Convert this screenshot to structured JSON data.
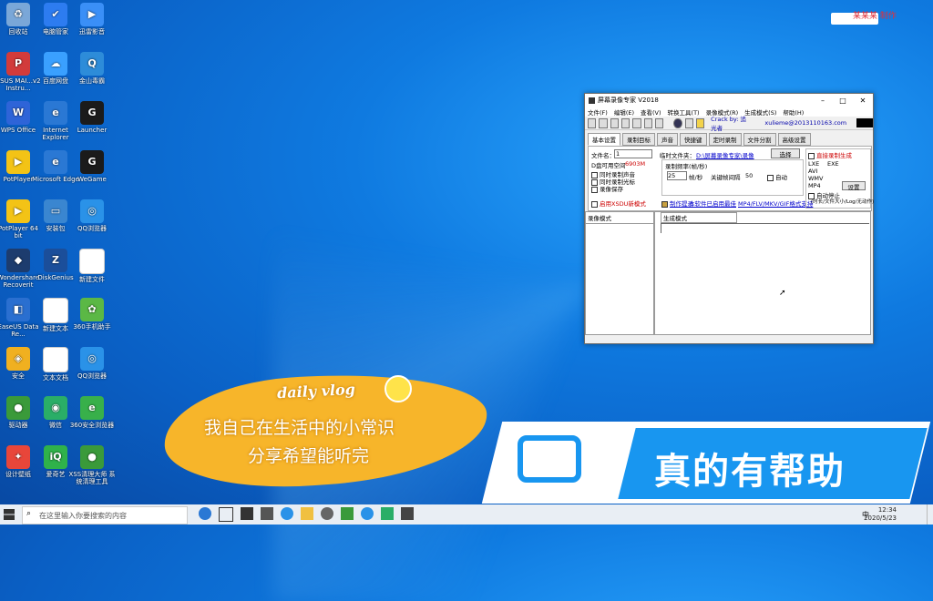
{
  "desktop": {
    "icons": [
      {
        "label": "回收站",
        "color": "#7aa7d8",
        "glyph": "♻"
      },
      {
        "label": "电脑管家",
        "color": "#2d7cf0",
        "glyph": "✔"
      },
      {
        "label": "迅雷影音",
        "color": "#3a8ff7",
        "glyph": "▶"
      },
      {
        "label": "ASUS MAI...v2 Instru...",
        "color": "#d23b3b",
        "glyph": "P"
      },
      {
        "label": "百度网盘",
        "color": "#3aa0ff",
        "glyph": "☁"
      },
      {
        "label": "金山毒霸",
        "color": "#2d8cd9",
        "glyph": "Q"
      },
      {
        "label": "WPS Office",
        "color": "#2e64d8",
        "glyph": "W"
      },
      {
        "label": "Internet Explorer",
        "color": "#2a78d4",
        "glyph": "e"
      },
      {
        "label": "Launcher",
        "color": "#1b1b1b",
        "glyph": "G"
      },
      {
        "label": "PotPlayer",
        "color": "#f3c316",
        "glyph": "▶"
      },
      {
        "label": "Microsoft Edge",
        "color": "#2a78d4",
        "glyph": "e"
      },
      {
        "label": "WeGame",
        "color": "#1b1b1b",
        "glyph": "G"
      },
      {
        "label": "PotPlayer 64 bit",
        "color": "#f3c316",
        "glyph": "▶"
      },
      {
        "label": "安装包",
        "color": "#3a86d0",
        "glyph": "▭"
      },
      {
        "label": "QQ浏览器",
        "color": "#2a92e8",
        "glyph": "◎"
      },
      {
        "label": "Wondershare Recoverit",
        "color": "#1d3c6e",
        "glyph": "◆"
      },
      {
        "label": "DiskGenius",
        "color": "#1b4e9a",
        "glyph": "Z"
      },
      {
        "label": "新建文件",
        "color": "#ffffff",
        "glyph": ""
      },
      {
        "label": "EaseUS Data Re...",
        "color": "#2a6fd0",
        "glyph": "◧"
      },
      {
        "label": "新建文本",
        "color": "#ffffff",
        "glyph": ""
      },
      {
        "label": "360手机助手",
        "color": "#5bb845",
        "glyph": "✿"
      },
      {
        "label": "安全",
        "color": "#f0b020",
        "glyph": "◈"
      },
      {
        "label": "文本文档",
        "color": "#ffffff",
        "glyph": ""
      },
      {
        "label": "QQ浏览器",
        "color": "#2a92e8",
        "glyph": "◎"
      },
      {
        "label": "驱动器",
        "color": "#3a9a3a",
        "glyph": "●"
      },
      {
        "label": "微信",
        "color": "#2aae67",
        "glyph": "◉"
      },
      {
        "label": "360安全浏览器",
        "color": "#38b04a",
        "glyph": "e"
      },
      {
        "label": "设计壁纸",
        "color": "#e8463a",
        "glyph": "✦"
      },
      {
        "label": "爱奇艺",
        "color": "#2fb24a",
        "glyph": "iQ"
      },
      {
        "label": "XSS清理大师 系统清理工具",
        "color": "#3a9a3a",
        "glyph": "●"
      }
    ]
  },
  "watermark": {
    "top_right": "某某某 制作"
  },
  "window": {
    "title": "屏幕录像专家 V2018",
    "menu": [
      "文件(F)",
      "编辑(E)",
      "查看(V)",
      "转换工具(T)",
      "录像模式(R)",
      "生成模式(S)",
      "帮助(H)"
    ],
    "crack_text": "Crack by: 追光者",
    "email_text": "xulieme@2013110163.com",
    "tabs": [
      "基本设置",
      "录制目标",
      "声音",
      "快捷键",
      "定时录制",
      "文件分割",
      "高级设置"
    ],
    "active_tab": "基本设置",
    "filename_label": "文件名：",
    "filename_value": "1",
    "tmp_folder_label": "临时文件夹：",
    "tmp_folder_value": "D:\\屏幕录像专家\\录像",
    "select_button": "选择",
    "disk_space": "D盘可用空间",
    "disk_space_value": "6903M",
    "frame_label": "录制频率(帧/秒)",
    "frame_value": "25",
    "frame_unit": "帧/秒",
    "auto_label": "自动",
    "keyframe_label": "关键帧间隔",
    "keyframe_value": "50",
    "checks": [
      "同时录制声音",
      "同时录制光标",
      "录像保存"
    ],
    "right_check_1": "直接录制生成",
    "radio_lxe": "LXE",
    "radio_exe": "EXE",
    "radio_avi": "AVI",
    "radio_wmv": "WMV",
    "radio_mp4": "MP4",
    "settings_btn": "设置",
    "auto_stop": "自动停止",
    "auto_check_text": "(时长/文件大小/Log/无动作)",
    "new_mode": "启用XSDU新模式",
    "make_tips": "制作提示",
    "watch_link": "MP4/FLV/MKV/GIF格式支持",
    "tip_link": "本软件已启用最佳",
    "list_header": "录像模式",
    "gen_header": "生成模式"
  },
  "overlay": {
    "vlog_title": "daily vlog",
    "line1": "我自己在生活中的小常识",
    "line2": "分享希望能听完",
    "big": "真的有帮助"
  },
  "taskbar": {
    "search_placeholder": "在这里输入你要搜索的内容",
    "time": "12:34",
    "date": "2020/5/23",
    "ime": "中"
  }
}
